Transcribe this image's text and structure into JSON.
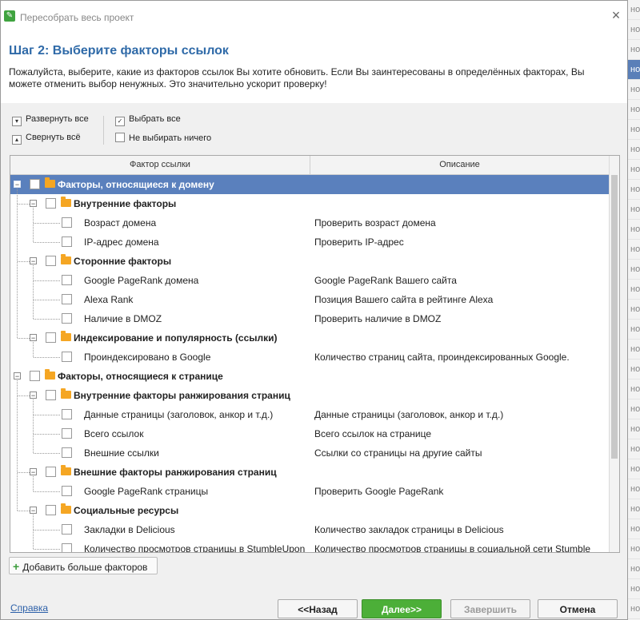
{
  "background_rows": [
    "но",
    "но",
    "но",
    "но",
    "но",
    "но",
    "но",
    "но",
    "но",
    "но",
    "но",
    "но",
    "но",
    "но",
    "но",
    "но",
    "но",
    "но",
    "но",
    "но",
    "но",
    "но",
    "но",
    "но",
    "но",
    "но",
    "но",
    "но",
    "но",
    "но",
    "но",
    "но"
  ],
  "window": {
    "title": "Пересобрать весь проект",
    "close_glyph": "×"
  },
  "header": {
    "step_title": "Шаг 2: Выберите факторы ссылок",
    "description": "Пожалуйста, выберите, какие из факторов ссылок Вы хотите обновить. Если Вы заинтересованы в определённых факторах, Вы можете отменить выбор ненужных. Это значительно ускорит проверку!"
  },
  "toolbar": {
    "expand_all": "Развернуть все",
    "collapse_all": "Свернуть всё",
    "select_all": "Выбрать все",
    "select_none": "Не выбирать ничего"
  },
  "columns": {
    "factor": "Фактор ссылки",
    "description": "Описание"
  },
  "tree": [
    {
      "level": 0,
      "group": true,
      "label": "Факторы, относящиеся к домену",
      "desc": "",
      "selected": true
    },
    {
      "level": 1,
      "group": true,
      "label": "Внутренние факторы",
      "desc": ""
    },
    {
      "level": 2,
      "group": false,
      "label": "Возраст домена",
      "desc": "Проверить возраст домена"
    },
    {
      "level": 2,
      "group": false,
      "label": "IP-адрес домена",
      "desc": "Проверить IP-адрес"
    },
    {
      "level": 1,
      "group": true,
      "label": "Сторонние факторы",
      "desc": ""
    },
    {
      "level": 2,
      "group": false,
      "label": "Google PageRank домена",
      "desc": "Google PageRank Вашего сайта"
    },
    {
      "level": 2,
      "group": false,
      "label": "Alexa Rank",
      "desc": "Позиция Вашего сайта в рейтинге Alexa"
    },
    {
      "level": 2,
      "group": false,
      "label": "Наличие в DMOZ",
      "desc": "Проверить наличие в DMOZ"
    },
    {
      "level": 1,
      "group": true,
      "label": "Индексирование и популярность (ссылки)",
      "desc": ""
    },
    {
      "level": 2,
      "group": false,
      "label": "Проиндексировано в Google",
      "desc": "Количество страниц сайта, проиндексированных Google."
    },
    {
      "level": 0,
      "group": true,
      "label": "Факторы, относящиеся к странице",
      "desc": ""
    },
    {
      "level": 1,
      "group": true,
      "label": "Внутренние факторы ранжирования страниц",
      "desc": ""
    },
    {
      "level": 2,
      "group": false,
      "label": "Данные страницы (заголовок, анкор и т.д.)",
      "desc": "Данные страницы (заголовок, анкор и т.д.)"
    },
    {
      "level": 2,
      "group": false,
      "label": "Всего ссылок",
      "desc": "Всего ссылок на странице"
    },
    {
      "level": 2,
      "group": false,
      "label": "Внешние ссылки",
      "desc": "Ссылки со страницы на другие сайты"
    },
    {
      "level": 1,
      "group": true,
      "label": "Внешние факторы ранжирования страниц",
      "desc": ""
    },
    {
      "level": 2,
      "group": false,
      "label": "Google PageRank страницы",
      "desc": "Проверить Google PageRank"
    },
    {
      "level": 1,
      "group": true,
      "label": "Социальные ресурсы",
      "desc": ""
    },
    {
      "level": 2,
      "group": false,
      "label": "Закладки в Delicious",
      "desc": "Количество закладок страницы в Delicious"
    },
    {
      "level": 2,
      "group": false,
      "label": "Количество просмотров страницы в StumbleUpon",
      "desc": "Количество просмотров страницы в социальной сети Stumble"
    }
  ],
  "add_factors": "Добавить больше факторов",
  "help_link": "Справка",
  "buttons": {
    "back": "<<Назад",
    "next": "Далее>>",
    "finish": "Завершить",
    "cancel": "Отмена"
  },
  "colors": {
    "accent": "#2f6aa8",
    "selection": "#5a80bd",
    "next_button": "#4caf38",
    "folder": "#f5a623"
  }
}
